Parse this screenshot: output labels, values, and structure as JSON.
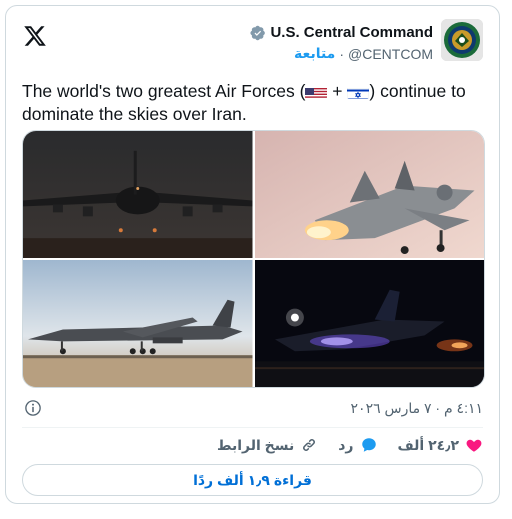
{
  "author": {
    "display_name": "U.S. Central Command",
    "handle": "@CENTCOM",
    "follow_label": "متابعة",
    "separator": "·"
  },
  "tweet": {
    "text_part1": "The world's two greatest Air Forces (",
    "text_plus": " + ",
    "text_part2": ") continue to dominate the skies over Iran.",
    "flags": [
      "us-flag-icon",
      "israel-flag-icon"
    ]
  },
  "media": {
    "tiles": [
      {
        "name": "photo-b52-bomber"
      },
      {
        "name": "photo-f35-fighter"
      },
      {
        "name": "photo-b1-bomber"
      },
      {
        "name": "photo-night-fighter"
      }
    ]
  },
  "meta": {
    "timestamp": "٤:١١ م · ٧ مارس ٢٠٢٦"
  },
  "actions": {
    "like_count": "٢٤٫٢ ألف",
    "reply_label": "رد",
    "copy_link_label": "نسخ الرابط"
  },
  "read_replies": "قراءة ١٫٩ ألف ردًا",
  "colors": {
    "accent": "#1d9bf0",
    "like": "#f91880",
    "text": "#0f1419",
    "muted": "#536471"
  }
}
